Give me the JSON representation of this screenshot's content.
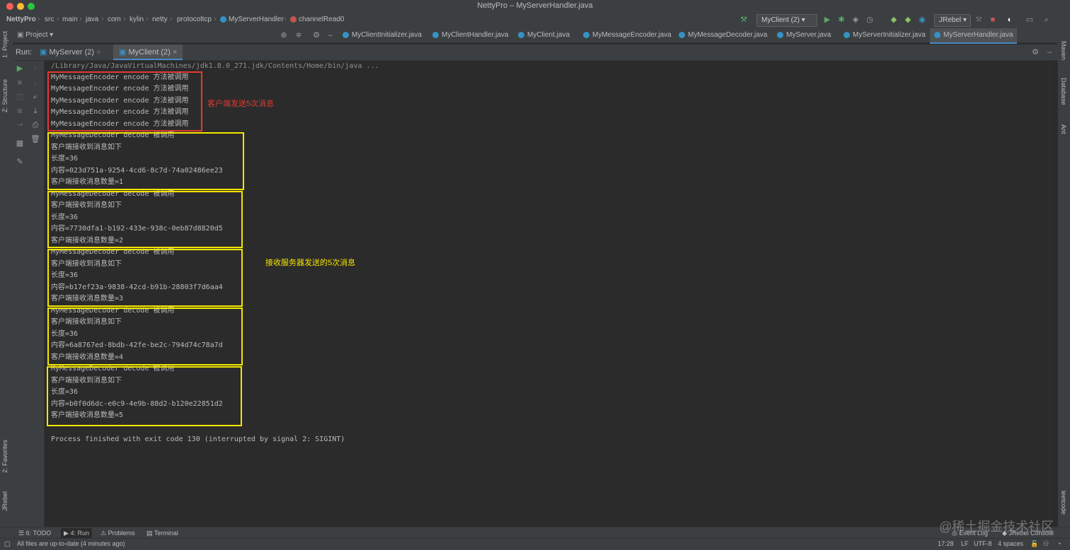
{
  "window": {
    "title": "NettyPro – MyServerHandler.java"
  },
  "breadcrumb": [
    "NettyPro",
    "src",
    "main",
    "java",
    "com",
    "kylin",
    "netty",
    "protocoltcp",
    "MyServerHandler",
    "channelRead0"
  ],
  "toolbar": {
    "run_config": "MyClient (2)",
    "jrebel": "JRebel"
  },
  "project_panel": {
    "label": "Project"
  },
  "editor_tabs": [
    "MyClientInitializer.java",
    "MyClientHandler.java",
    "MyClient.java",
    "MyMessageEncoder.java",
    "MyMessageDecoder.java",
    "MyServer.java",
    "MyServerInitializer.java",
    "MyServerHandler.java"
  ],
  "run_panel": {
    "label": "Run:",
    "tabs": [
      "MyServer (2)",
      "MyClient (2)"
    ]
  },
  "console": {
    "lines": [
      "/Library/Java/JavaVirtualMachines/jdk1.8.0_271.jdk/Contents/Home/bin/java ...",
      "MyMessageEncoder encode 方法被调用",
      "MyMessageEncoder encode 方法被调用",
      "MyMessageEncoder encode 方法被调用",
      "MyMessageEncoder encode 方法被调用",
      "MyMessageEncoder encode 方法被调用",
      "MyMessageDecoder decode 被调用",
      "客户端接收到消息如下",
      "长度=36",
      "内容=023d751a-9254-4cd6-8c7d-74a02486ee23",
      "客户端接收消息数量=1",
      "MyMessageDecoder decode 被调用",
      "客户端接收到消息如下",
      "长度=36",
      "内容=7730dfa1-b192-433e-938c-0eb87d8820d5",
      "客户端接收消息数量=2",
      "MyMessageDecoder decode 被调用",
      "客户端接收到消息如下",
      "长度=36",
      "内容=b17ef23a-9838-42cd-b91b-28803f7d6aa4",
      "客户端接收消息数量=3",
      "MyMessageDecoder decode 被调用",
      "客户端接收到消息如下",
      "长度=36",
      "内容=6a8767ed-8bdb-42fe-be2c-794d74c78a7d",
      "客户端接收消息数量=4",
      "MyMessageDecoder decode 被调用",
      "客户端接收到消息如下",
      "长度=36",
      "内容=b0f0d6dc-e0c9-4e9b-88d2-b120e22851d2",
      "客户端接收消息数量=5",
      "",
      "Process finished with exit code 130 (interrupted by signal 2: SIGINT)"
    ]
  },
  "annotations": {
    "client_sent": "客户端发送5次消息",
    "received": "接收服务器发送的5次消息",
    "red_color": "#e23a30",
    "yellow_color": "#f5e600"
  },
  "left_sidebar": {
    "project": "1: Project",
    "structure": "Z: Structure",
    "favorites": "2: Favorites",
    "jrebel": "JRebel"
  },
  "right_sidebar": {
    "maven": "Maven",
    "database": "Database",
    "ant": "Ant",
    "leetcode": "leetcode"
  },
  "bottom_tabs": {
    "todo": "6: TODO",
    "run": "4: Run",
    "problems": "Problems",
    "terminal": "Terminal",
    "event_log": "Event Log",
    "jrebel_console": "JRebel Console"
  },
  "status": {
    "message": "All files are up-to-date (4 minutes ago)",
    "position": "17:28",
    "line_sep": "LF",
    "encoding": "UTF-8",
    "indent": "4 spaces"
  },
  "watermark": "@稀土掘金技术社区"
}
